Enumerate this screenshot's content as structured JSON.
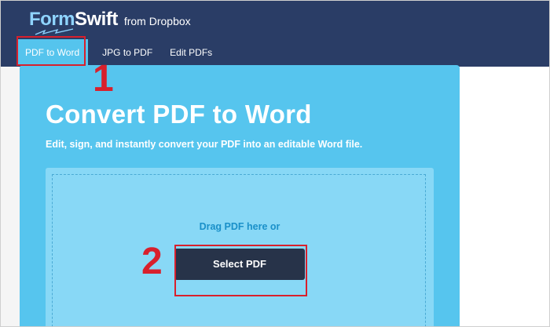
{
  "brand": {
    "name_part1": "Form",
    "name_part2": "Swift",
    "subtitle": "from Dropbox"
  },
  "nav": {
    "items": [
      {
        "label": "PDF to Word",
        "active": true
      },
      {
        "label": "JPG to PDF",
        "active": false
      },
      {
        "label": "Edit PDFs",
        "active": false
      }
    ]
  },
  "main": {
    "title": "Convert PDF to Word",
    "subtitle": "Edit, sign, and instantly convert your PDF into an editable Word file.",
    "drag_text": "Drag PDF here or",
    "select_button": "Select PDF"
  },
  "annotations": {
    "step1": "1",
    "step2": "2"
  },
  "colors": {
    "header": "#2a3d66",
    "accent": "#55c4ed",
    "button": "#273349",
    "annotation": "#d8202c"
  }
}
